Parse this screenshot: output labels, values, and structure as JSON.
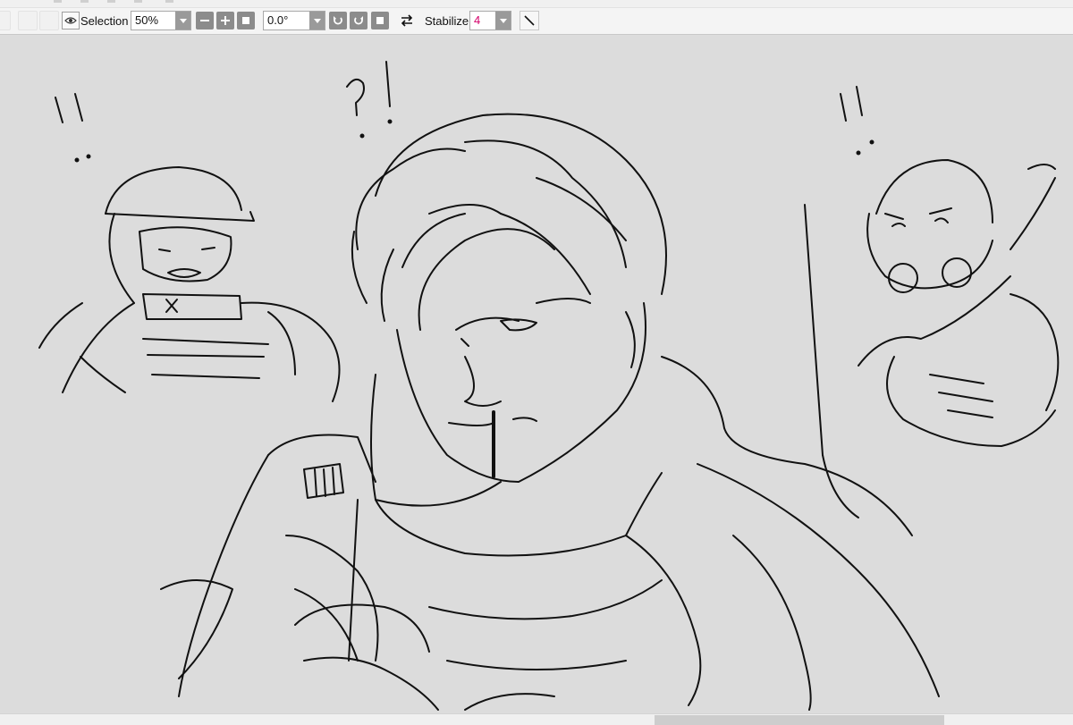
{
  "toolbar": {
    "visibility_icon": "eye-icon",
    "selection_label": "Selection",
    "zoom_value": "50%",
    "zoom_out_icon": "minus-icon",
    "zoom_in_icon": "plus-icon",
    "zoom_reset_icon": "square-icon",
    "rotation_value": "0.0°",
    "rotate_left_icon": "rotate-left-icon",
    "rotate_right_icon": "rotate-right-icon",
    "rotation_reset_icon": "square-icon",
    "flip_icon": "swap-arrows-icon",
    "stabilizer_label": "Stabilizer",
    "stabilizer_value": "4",
    "stabilizer_value_color": "#d4006a",
    "pen_icon": "diagonal-line-icon"
  },
  "canvas": {
    "background_color": "#dcdcdc",
    "artwork_marks": [
      "!!",
      "?!",
      "!!"
    ]
  },
  "scrollbar": {
    "position_fraction": 0.61,
    "visible_fraction": 0.27
  }
}
